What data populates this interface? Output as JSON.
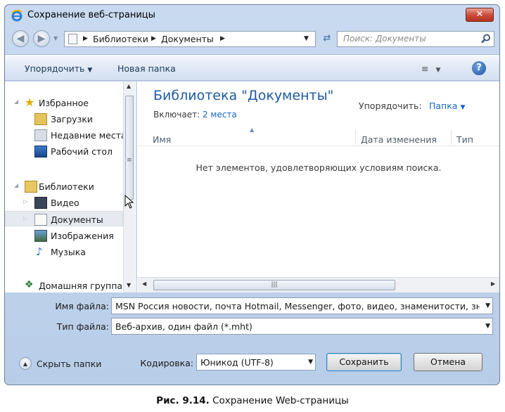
{
  "window": {
    "title": "Сохранение веб-страницы",
    "close_label": "✕"
  },
  "address": {
    "crumbs": [
      "Библиотеки",
      "Документы"
    ],
    "search_placeholder": "Поиск: Документы"
  },
  "toolbar": {
    "organize_label": "Упорядочить",
    "new_folder_label": "Новая папка",
    "help_label": "?"
  },
  "nav": {
    "favorites": "Избранное",
    "downloads": "Загрузки",
    "recent": "Недавние места",
    "desktop": "Рабочий стол",
    "libraries": "Библиотеки",
    "video": "Видео",
    "documents": "Документы",
    "images": "Изображения",
    "music": "Музыка",
    "homegroup": "Домашняя группа"
  },
  "content": {
    "title": "Библиотека \"Документы\"",
    "includes_label": "Включает:",
    "includes_link": "2 места",
    "arrange_label": "Упорядочить:",
    "arrange_value": "Папка",
    "columns": [
      "Имя",
      "Дата изменения",
      "Тип"
    ],
    "empty_message": "Нет элементов, удовлетворяющих условиям поиска."
  },
  "form": {
    "filename_label": "Имя файла:",
    "filename_value": "MSN Россия новости, почта Hotmail, Messenger, фото, видео, знаменитости, знакс",
    "filetype_label": "Тип файла:",
    "filetype_value": "Веб-архив, один файл  (*.mht)",
    "hide_folders_label": "Скрыть папки",
    "encoding_label": "Кодировка:",
    "encoding_value": "Юникод (UTF-8)",
    "save_label": "Сохранить",
    "cancel_label": "Отмена"
  },
  "caption": {
    "number": "Рис. 9.14.",
    "text": "Сохранение Web-страницы"
  }
}
